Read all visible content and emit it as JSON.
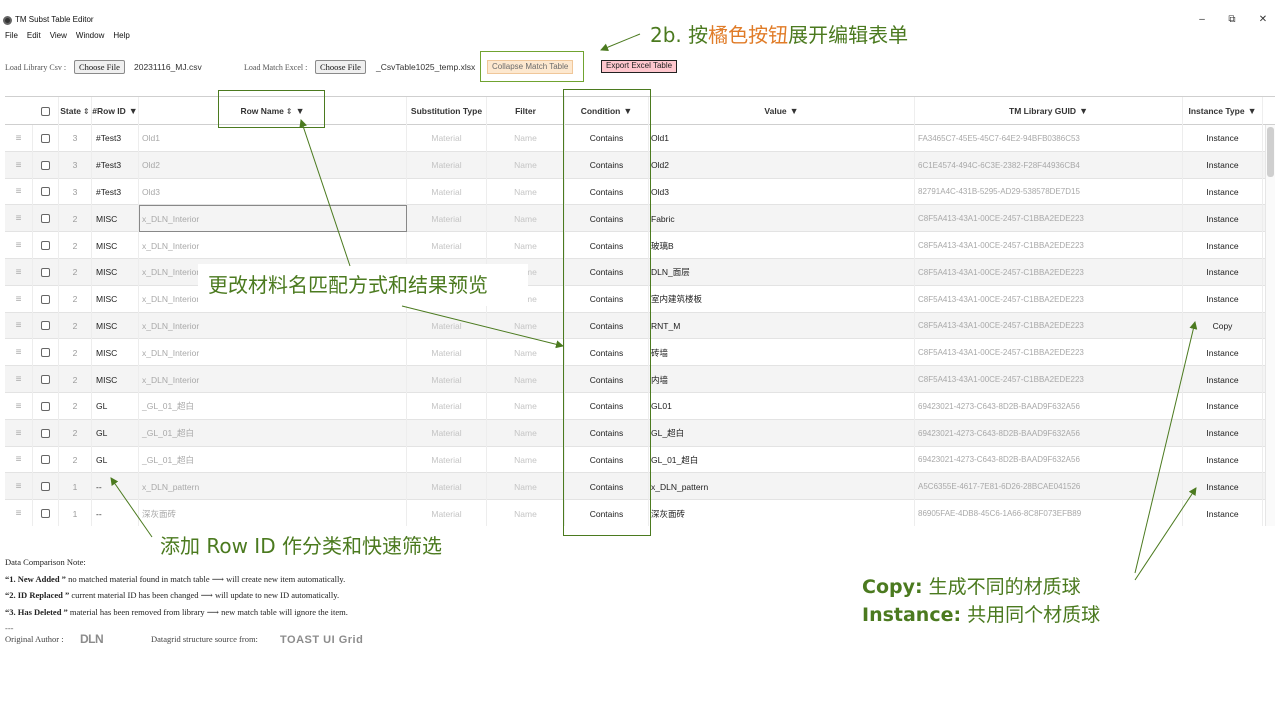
{
  "window": {
    "title": "TM Subst Table Editor",
    "minimize": "–",
    "maximize": "⧉",
    "close": "✕"
  },
  "menu": [
    "File",
    "Edit",
    "View",
    "Window",
    "Help"
  ],
  "toolbar": {
    "load_library_label": "Load Library Csv :",
    "choose_file": "Choose File",
    "library_file": "20231116_MJ.csv",
    "load_match_label": "Load Match Excel :",
    "match_file": "_CsvTable1025_temp.xlsx",
    "collapse_button": "Collapse Match Table",
    "export_button": "Export Excel Table"
  },
  "grid": {
    "headers": {
      "state": "State",
      "row_id": "#Row ID",
      "row_name": "Row Name",
      "substitution_type": "Substitution Type",
      "filter": "Filter",
      "condition": "Condition",
      "value": "Value",
      "guid": "TM Library GUID",
      "instance_type": "Instance Type"
    },
    "rows": [
      {
        "state": "3",
        "row_id": "#Test3",
        "name": "Old1",
        "sub": "Material",
        "filter": "Name",
        "condition": "Contains",
        "value": "Old1",
        "guid": "FA3465C7-45E5-45C7-64E2-94BFB0386C53",
        "instance": "Instance"
      },
      {
        "state": "3",
        "row_id": "#Test3",
        "name": "Old2",
        "sub": "Material",
        "filter": "Name",
        "condition": "Contains",
        "value": "Old2",
        "guid": "6C1E4574-494C-6C3E-2382-F28F44936CB4",
        "instance": "Instance"
      },
      {
        "state": "3",
        "row_id": "#Test3",
        "name": "Old3",
        "sub": "Material",
        "filter": "Name",
        "condition": "Contains",
        "value": "Old3",
        "guid": "82791A4C-431B-5295-AD29-538578DE7D15",
        "instance": "Instance"
      },
      {
        "state": "2",
        "row_id": "MISC",
        "name": "x_DLN_Interior",
        "sub": "Material",
        "filter": "Name",
        "condition": "Contains",
        "value": "Fabric",
        "guid": "C8F5A413-43A1-00CE-2457-C1BBA2EDE223",
        "instance": "Instance"
      },
      {
        "state": "2",
        "row_id": "MISC",
        "name": "x_DLN_Interior",
        "sub": "Material",
        "filter": "Name",
        "condition": "Contains",
        "value": "玻璃B",
        "guid": "C8F5A413-43A1-00CE-2457-C1BBA2EDE223",
        "instance": "Instance"
      },
      {
        "state": "2",
        "row_id": "MISC",
        "name": "x_DLN_Interior",
        "sub": "Material",
        "filter": "Name",
        "condition": "Contains",
        "value": "DLN_面层",
        "guid": "C8F5A413-43A1-00CE-2457-C1BBA2EDE223",
        "instance": "Instance"
      },
      {
        "state": "2",
        "row_id": "MISC",
        "name": "x_DLN_Interior",
        "sub": "Material",
        "filter": "Name",
        "condition": "Contains",
        "value": "室内建筑楼板",
        "guid": "C8F5A413-43A1-00CE-2457-C1BBA2EDE223",
        "instance": "Instance"
      },
      {
        "state": "2",
        "row_id": "MISC",
        "name": "x_DLN_Interior",
        "sub": "Material",
        "filter": "Name",
        "condition": "Contains",
        "value": "RNT_M",
        "guid": "C8F5A413-43A1-00CE-2457-C1BBA2EDE223",
        "instance": "Copy"
      },
      {
        "state": "2",
        "row_id": "MISC",
        "name": "x_DLN_Interior",
        "sub": "Material",
        "filter": "Name",
        "condition": "Contains",
        "value": "砖墙",
        "guid": "C8F5A413-43A1-00CE-2457-C1BBA2EDE223",
        "instance": "Instance"
      },
      {
        "state": "2",
        "row_id": "MISC",
        "name": "x_DLN_Interior",
        "sub": "Material",
        "filter": "Name",
        "condition": "Contains",
        "value": "内墙",
        "guid": "C8F5A413-43A1-00CE-2457-C1BBA2EDE223",
        "instance": "Instance"
      },
      {
        "state": "2",
        "row_id": "GL",
        "name": "_GL_01_超白",
        "sub": "Material",
        "filter": "Name",
        "condition": "Contains",
        "value": "GL01",
        "guid": "69423021-4273-C643-8D2B-BAAD9F632A56",
        "instance": "Instance"
      },
      {
        "state": "2",
        "row_id": "GL",
        "name": "_GL_01_超白",
        "sub": "Material",
        "filter": "Name",
        "condition": "Contains",
        "value": "GL_超白",
        "guid": "69423021-4273-C643-8D2B-BAAD9F632A56",
        "instance": "Instance"
      },
      {
        "state": "2",
        "row_id": "GL",
        "name": "_GL_01_超白",
        "sub": "Material",
        "filter": "Name",
        "condition": "Contains",
        "value": "GL_01_超白",
        "guid": "69423021-4273-C643-8D2B-BAAD9F632A56",
        "instance": "Instance"
      },
      {
        "state": "1",
        "row_id": "--",
        "name": "x_DLN_pattern",
        "sub": "Material",
        "filter": "Name",
        "condition": "Contains",
        "value": "x_DLN_pattern",
        "guid": "A5C6355E-4617-7E81-6D26-28BCAE041526",
        "instance": "Instance"
      },
      {
        "state": "1",
        "row_id": "--",
        "name": "深灰面砖",
        "sub": "Material",
        "filter": "Name",
        "condition": "Contains",
        "value": "深灰面砖",
        "guid": "86905FAE-4DB8-45C6-1A66-8C8F073EFB89",
        "instance": "Instance"
      }
    ]
  },
  "notes": {
    "title": "Data Comparison Note:",
    "items": [
      {
        "key": "“1. New Added ”",
        "text": " no matched material found in match table ⟶ will create new item automatically."
      },
      {
        "key": "“2. ID Replaced ”",
        "text": " current material ID has been changed ⟶ will update to new ID automatically."
      },
      {
        "key": "“3. Has Deleted ”",
        "text": " material has been removed from library ⟶ new match table will ignore the item."
      }
    ],
    "separator": "---",
    "author_label": "Original Author :",
    "author_logo": "DLN",
    "source_label": "Datagrid structure source from:",
    "source_logo": "TOAST UI Grid"
  },
  "annotations": {
    "top_prefix": "2b. 按",
    "top_orange": "橘色按钮",
    "top_suffix": "展开编辑表单",
    "middle": "更改材料名匹配方式和结果预览",
    "rowid": "添加 Row ID 作分类和快速筛选",
    "copy_key": "Copy:",
    "copy_text": " 生成不同的材质球",
    "instance_key": "Instance:",
    "instance_text": " 共用同个材质球"
  },
  "colors": {
    "annotation_green": "#4b7a1f",
    "annotation_orange": "#e07c28",
    "collapse_button_bg": "#fde8cf",
    "export_button_bg": "#ffc7ce"
  }
}
